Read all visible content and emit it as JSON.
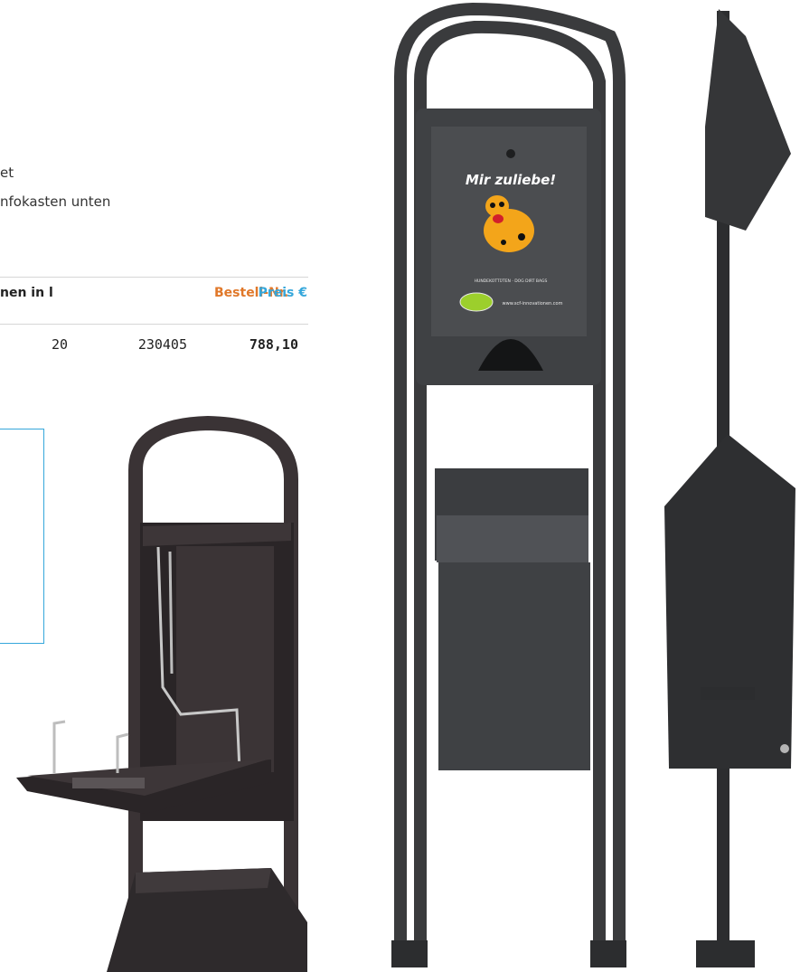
{
  "description": {
    "line1": "et",
    "line2": "nfokasten unten"
  },
  "table": {
    "headers": {
      "volume": "nen in l",
      "order_no": "Bestell-Nr.",
      "price": "Preis €"
    },
    "row": {
      "volume": "20",
      "order_no": "230405",
      "price": "788,10"
    }
  },
  "product_label": {
    "slogan": "Mir zuliebe!",
    "bags_text": "HUNDEKOTTÜTEN · DOG DIRT BAGS",
    "website": "www.scf-innovationen.com"
  },
  "colors": {
    "order_header": "#e0782a",
    "price_header": "#35a7db",
    "infobox_border": "#35a7db",
    "frame_dark": "#3a3b3d",
    "box_dark": "#45474a"
  }
}
